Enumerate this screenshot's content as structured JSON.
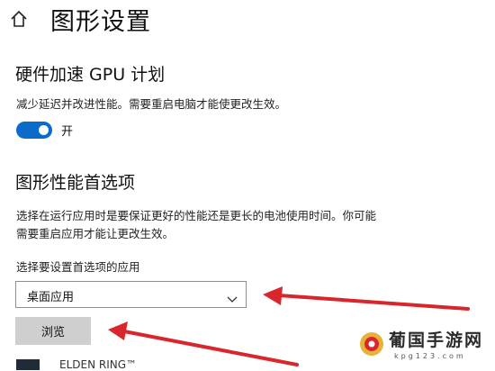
{
  "page": {
    "title": "图形设置"
  },
  "icons": {
    "home": "home-icon",
    "dropdown": "chevron-down-icon",
    "watermark": "watermark-logo-icon"
  },
  "gpu_scheduling": {
    "heading": "硬件加速 GPU 计划",
    "description": "减少延迟并改进性能。需要重启电脑才能使更改生效。",
    "toggle_state_label": "开",
    "toggle_on": true
  },
  "graphics_preference": {
    "heading": "图形性能首选项",
    "description_line1": "选择在运行应用时是要保证更好的性能还是更长的电池使用时间。你可能",
    "description_line2": "需要重启应用才能让更改生效。",
    "select_label": "选择要设置首选项的应用",
    "select_value": "桌面应用",
    "browse_label": "浏览",
    "app_list": [
      {
        "name": "ELDEN RING™"
      }
    ]
  },
  "watermark": {
    "title": "葡国手游网",
    "subtitle": "kpg123.com"
  },
  "colors": {
    "accent": "#0b6bcb",
    "arrow": "#d9262c",
    "button_bg": "#cfcfcf"
  }
}
